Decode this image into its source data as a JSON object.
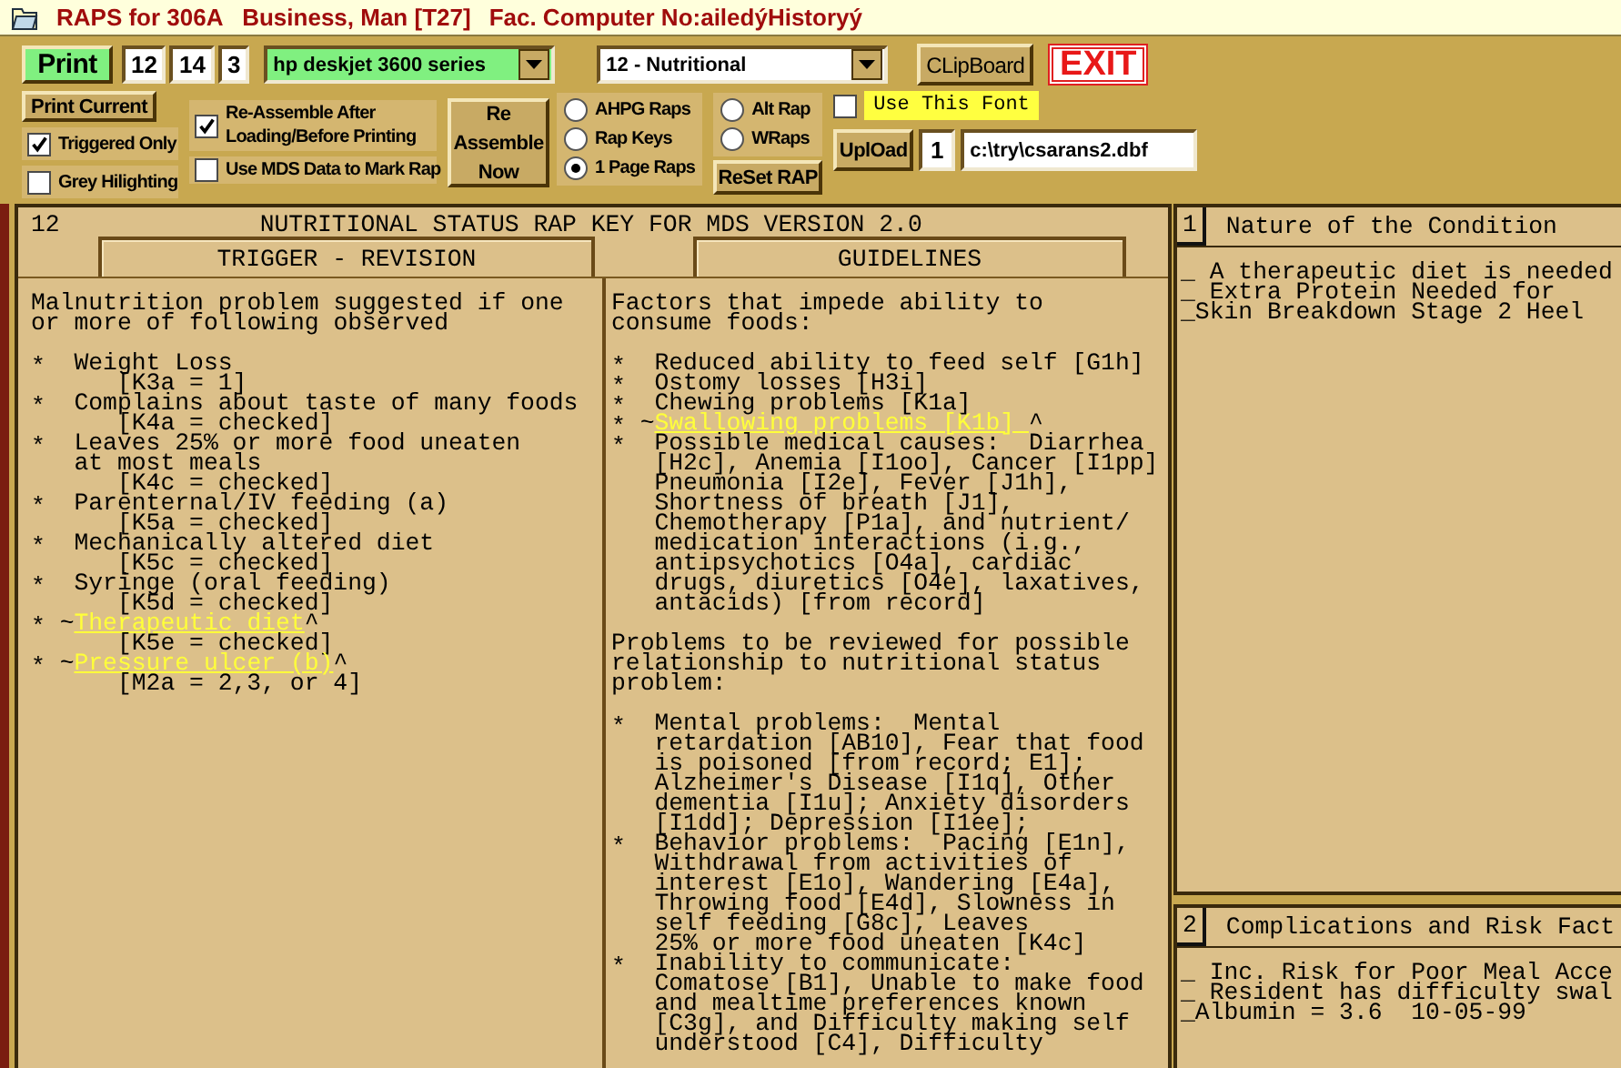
{
  "window": {
    "title": "RAPS for 306A   Business, Man [T27]",
    "subtitle": "Fac. Computer No:ailedýHistoryý"
  },
  "toolbar": {
    "print_button": "Print",
    "page_fields": [
      "12",
      "14",
      "3"
    ],
    "printer_select": {
      "value": "hp deskjet 3600 series"
    },
    "rap_select": {
      "value": "12 - Nutritional"
    },
    "clipboard_button": "CLipBoard",
    "exit_button": "EXIT",
    "print_current_button": "Print Current",
    "left_options": [
      {
        "label": "Triggered Only",
        "checked": true
      },
      {
        "label": "Grey Hilighting",
        "checked": false
      }
    ],
    "mid_options": [
      {
        "label": "Re-Assemble After\nLoading/Before Printing",
        "checked": true
      },
      {
        "label": "Use MDS Data to Mark Rap",
        "checked": false
      }
    ],
    "reassemble_button": "Re\nAssemble\nNow",
    "rap_type_radios": [
      {
        "label": "AHPG Raps",
        "selected": false
      },
      {
        "label": "Rap Keys",
        "selected": false
      },
      {
        "label": "1 Page Raps",
        "selected": true
      }
    ],
    "alt_radios": [
      {
        "label": "Alt Rap",
        "selected": false
      },
      {
        "label": "WRaps",
        "selected": false
      }
    ],
    "reset_button": "ReSet RAP",
    "font_option": {
      "label": "Use This Font",
      "checked": false
    },
    "upload_button": "UplOad",
    "upload_count": "1",
    "upload_path": "c:\\try\\csarans2.dbf"
  },
  "rap_key": {
    "number": "12",
    "title": "NUTRITIONAL STATUS RAP KEY FOR MDS VERSION 2.0",
    "columns": [
      {
        "heading": "TRIGGER - REVISION",
        "blocks": [
          {
            "kind": "paragraph",
            "text": "Malnutrition problem suggested if one\nor more of following observed"
          },
          {
            "kind": "item",
            "bullet": "*",
            "text": "Weight Loss",
            "code": "[K3a = 1]"
          },
          {
            "kind": "item",
            "bullet": "*",
            "text": "Complains about taste of many foods",
            "code": "[K4a = checked]"
          },
          {
            "kind": "item",
            "bullet": "*",
            "text": "Leaves 25% or more food uneaten\nat most meals",
            "code": "[K4c = checked]"
          },
          {
            "kind": "item",
            "bullet": "*",
            "text": "Parenternal/IV feeding (a)",
            "code": "[K5a = checked]"
          },
          {
            "kind": "item",
            "bullet": "*",
            "text": "Mechanically altered diet",
            "code": "[K5c = checked]"
          },
          {
            "kind": "item",
            "bullet": "*",
            "text": "Syringe (oral feeding)",
            "code": "[K5d = checked]"
          },
          {
            "kind": "link_item",
            "bullet": "*",
            "prefix": "~",
            "link": "Therapeutic diet",
            "suffix": "^",
            "code": "[K5e = checked]"
          },
          {
            "kind": "link_item",
            "bullet": "*",
            "prefix": "~",
            "link": "Pressure ulcer (b)",
            "suffix": "^",
            "code": "[M2a = 2,3, or 4]"
          }
        ]
      },
      {
        "heading": "GUIDELINES",
        "blocks": [
          {
            "kind": "paragraph",
            "text": "Factors that impede ability to\nconsume foods:"
          },
          {
            "kind": "item",
            "bullet": "*",
            "text": "Reduced ability to feed self [G1h]"
          },
          {
            "kind": "item",
            "bullet": "*",
            "text": "Ostomy losses [H3i]"
          },
          {
            "kind": "item",
            "bullet": "*",
            "text": "Chewing problems [K1a]"
          },
          {
            "kind": "link_item",
            "bullet": "*",
            "prefix": "~",
            "link": "Swallowing problems [K1b] ",
            "suffix": "^"
          },
          {
            "kind": "item",
            "bullet": "*",
            "text": "Possible medical causes:  Diarrhea\n[H2c], Anemia [I1oo], Cancer [I1pp]\nPneumonia [I2e], Fever [J1h],\nShortness of breath [J1],\nChemotherapy [P1a], and nutrient/\nmedication interactions (i.g.,\nantipsychotics [O4a], cardiac\ndrugs, diuretics [O4e], laxatives,\nantacids) [from record]"
          },
          {
            "kind": "paragraph",
            "text": "Problems to be reviewed for possible\nrelationship to nutritional status\nproblem:"
          },
          {
            "kind": "item",
            "bullet": "*",
            "text": "Mental problems:  Mental\nretardation [AB10], Fear that food\nis poisoned [from record; E1];\nAlzheimer's Disease [I1q], Other\ndementia [I1u]; Anxiety disorders\n[I1dd]; Depression [I1ee];"
          },
          {
            "kind": "item",
            "bullet": "*",
            "text": "Behavior problems:  Pacing [E1n],\nWithdrawal from activities of\ninterest [E1o], Wandering [E4a],\nThrowing food [E4d], Slowness in\nself feeding [G8c], Leaves\n25% or more food uneaten [K4c]"
          },
          {
            "kind": "item",
            "bullet": "*",
            "text": "Inability to communicate:\nComatose [B1], Unable to make food\nand mealtime preferences known\n[C3g], and Difficulty making self\nunderstood [C4], Difficulty"
          }
        ]
      }
    ]
  },
  "side_panels": [
    {
      "number": "1",
      "title": "Nature of the Condition",
      "lines": [
        "_ A therapeutic diet is needed",
        "_ Extra Protein Needed for",
        "_Skin Breakdown Stage 2 Heel"
      ]
    },
    {
      "number": "2",
      "title": "Complications and Risk Fact",
      "lines": [
        "_ Inc. Risk for Poor Meal Acce",
        "_ Resident has difficulty swal",
        "_Albumin = 3.6  10-05-99"
      ]
    }
  ]
}
